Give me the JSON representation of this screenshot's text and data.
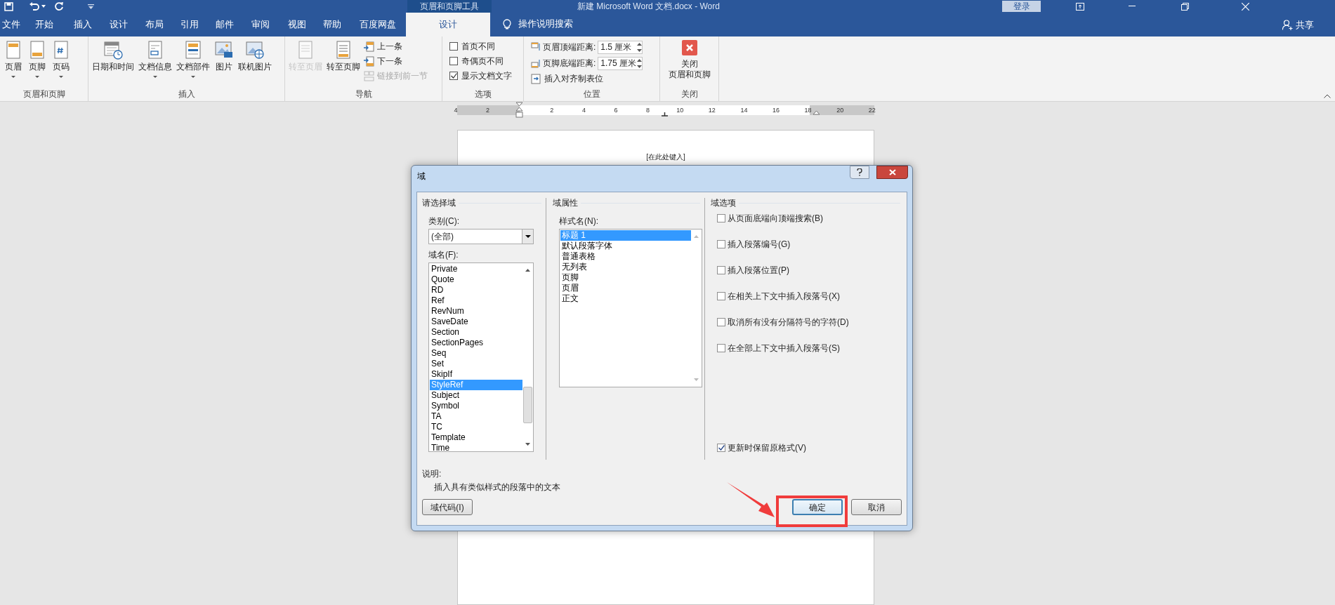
{
  "title_bar": {
    "context_group": "页眉和页脚工具",
    "title": "新建 Microsoft Word 文档.docx - Word",
    "sign_in": "登录"
  },
  "tabs": [
    {
      "label": "文件",
      "selected": false
    },
    {
      "label": "开始",
      "selected": false
    },
    {
      "label": "插入",
      "selected": false
    },
    {
      "label": "设计",
      "selected": false
    },
    {
      "label": "布局",
      "selected": false
    },
    {
      "label": "引用",
      "selected": false
    },
    {
      "label": "邮件",
      "selected": false
    },
    {
      "label": "审阅",
      "selected": false
    },
    {
      "label": "视图",
      "selected": false
    },
    {
      "label": "帮助",
      "selected": false
    },
    {
      "label": "百度网盘",
      "selected": false
    },
    {
      "label": "设计",
      "selected": true
    }
  ],
  "tell_me": "操作说明搜索",
  "share": "共享",
  "ribbon_groups": [
    {
      "label": "页眉和页脚",
      "items": [
        {
          "kind": "large",
          "label": "页眉",
          "dropdown": true,
          "disabled": false
        },
        {
          "kind": "large",
          "label": "页脚",
          "dropdown": true,
          "disabled": false
        },
        {
          "kind": "large",
          "label": "页码",
          "dropdown": true,
          "disabled": false
        }
      ]
    },
    {
      "label": "插入",
      "items": [
        {
          "kind": "large",
          "label": "日期和时间",
          "dropdown": false,
          "disabled": false
        },
        {
          "kind": "large",
          "label": "文档信息",
          "dropdown": true,
          "disabled": false
        },
        {
          "kind": "large",
          "label": "文档部件",
          "dropdown": true,
          "disabled": false
        },
        {
          "kind": "large",
          "label": "图片",
          "dropdown": false,
          "disabled": false
        },
        {
          "kind": "large",
          "label": "联机图片",
          "dropdown": false,
          "disabled": false
        }
      ]
    },
    {
      "label": "导航",
      "items": [
        {
          "kind": "large",
          "label": "转至页眉",
          "dropdown": false,
          "disabled": true
        },
        {
          "kind": "large",
          "label": "转至页脚",
          "dropdown": false,
          "disabled": false
        },
        {
          "kind": "small",
          "label": "上一条",
          "disabled": false
        },
        {
          "kind": "small",
          "label": "下一条",
          "disabled": false
        },
        {
          "kind": "small",
          "label": "链接到前一节",
          "disabled": true
        }
      ]
    },
    {
      "label": "选项",
      "items": [
        {
          "kind": "checkbox",
          "label": "首页不同",
          "checked": false
        },
        {
          "kind": "checkbox",
          "label": "奇偶页不同",
          "checked": false
        },
        {
          "kind": "checkbox",
          "label": "显示文档文字",
          "checked": true
        }
      ]
    },
    {
      "label": "位置",
      "items": [
        {
          "kind": "spinner",
          "label": "页眉顶端距离:",
          "value": "1.5 厘米"
        },
        {
          "kind": "spinner",
          "label": "页脚底端距离:",
          "value": "1.75 厘米"
        },
        {
          "kind": "small",
          "label": "插入对齐制表位",
          "disabled": false
        }
      ]
    },
    {
      "label": "关闭",
      "items": [
        {
          "kind": "close",
          "lines": [
            "关闭",
            "页眉和页脚"
          ]
        }
      ]
    }
  ],
  "ruler": {
    "labels": [
      "4",
      "2",
      "2",
      "4",
      "6",
      "8",
      "10",
      "12",
      "14",
      "16",
      "18",
      "20",
      "22"
    ]
  },
  "page": {
    "header_text": "[在此处键入]"
  },
  "dialog": {
    "title": "域",
    "select_section": {
      "heading": "请选择域",
      "category_label": "类别(C):",
      "category_value": "(全部)",
      "field_names_label": "域名(F):",
      "field_names": [
        {
          "label": "Private",
          "selected": false
        },
        {
          "label": "Quote",
          "selected": false
        },
        {
          "label": "RD",
          "selected": false
        },
        {
          "label": "Ref",
          "selected": false
        },
        {
          "label": "RevNum",
          "selected": false
        },
        {
          "label": "SaveDate",
          "selected": false
        },
        {
          "label": "Section",
          "selected": false
        },
        {
          "label": "SectionPages",
          "selected": false
        },
        {
          "label": "Seq",
          "selected": false
        },
        {
          "label": "Set",
          "selected": false
        },
        {
          "label": "SkipIf",
          "selected": false
        },
        {
          "label": "StyleRef",
          "selected": true
        },
        {
          "label": "Subject",
          "selected": false
        },
        {
          "label": "Symbol",
          "selected": false
        },
        {
          "label": "TA",
          "selected": false
        },
        {
          "label": "TC",
          "selected": false
        },
        {
          "label": "Template",
          "selected": false
        },
        {
          "label": "Time",
          "selected": false
        }
      ]
    },
    "properties_section": {
      "heading": "域属性",
      "style_name_label": "样式名(N):",
      "style_names": [
        {
          "label": "标题 1",
          "selected": true
        },
        {
          "label": "默认段落字体",
          "selected": false
        },
        {
          "label": "普通表格",
          "selected": false
        },
        {
          "label": "无列表",
          "selected": false
        },
        {
          "label": "页脚",
          "selected": false
        },
        {
          "label": "页眉",
          "selected": false
        },
        {
          "label": "正文",
          "selected": false
        }
      ]
    },
    "options_section": {
      "heading": "域选项",
      "options": [
        {
          "label": "从页面底端向顶端搜索(B)",
          "checked": false
        },
        {
          "label": "插入段落编号(G)",
          "checked": false
        },
        {
          "label": "插入段落位置(P)",
          "checked": false
        },
        {
          "label": "在相关上下文中插入段落号(X)",
          "checked": false
        },
        {
          "label": "取消所有没有分隔符号的字符(D)",
          "checked": false
        },
        {
          "label": "在全部上下文中插入段落号(S)",
          "checked": false
        }
      ],
      "preserve_format": {
        "label": "更新时保留原格式(V)",
        "checked": true
      }
    },
    "description_label": "说明:",
    "description": "插入具有类似样式的段落中的文本",
    "field_codes_button": "域代码(I)",
    "ok_button": "确定",
    "cancel_button": "取消"
  }
}
